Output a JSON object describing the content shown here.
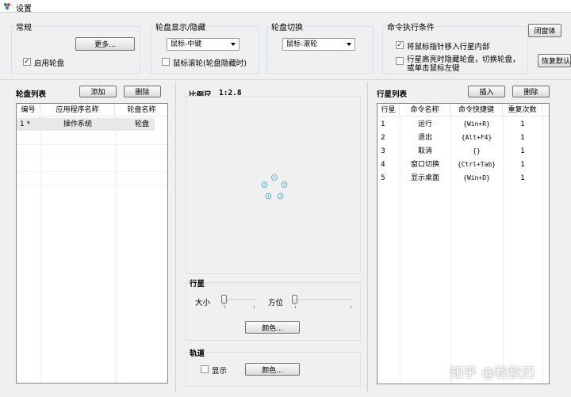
{
  "window": {
    "title": "设置"
  },
  "groups": {
    "general": {
      "label": "常规",
      "more_button": "更多...",
      "enable_wheel": "启用轮盘",
      "enable_wheel_checked": true
    },
    "display": {
      "label": "轮盘显示/隐藏",
      "combo_value": "鼠标-中键",
      "scroll_hide": "鼠标滚轮(轮盘隐藏时)",
      "scroll_hide_checked": false
    },
    "switch": {
      "label": "轮盘切换",
      "combo_value": "鼠标-滚轮"
    },
    "condition": {
      "label": "命令执行条件",
      "opt1": "将鼠标指针移入行星内部",
      "opt1_checked": true,
      "opt2_line1": "行星高亮时隐藏轮盘，切换轮盘，",
      "opt2_line2": "或单击鼠标左键",
      "opt2_checked": false
    }
  },
  "right_buttons": {
    "close": "闭窗体",
    "restore": "恢复默认"
  },
  "wheel_list": {
    "title": "轮盘列表",
    "add_button": "添加",
    "delete_button": "删除",
    "columns": [
      "编号",
      "应用程序名称",
      "轮盘名称"
    ],
    "rows": [
      [
        "1 *",
        "操作系统",
        "轮盘"
      ]
    ]
  },
  "scale": {
    "label": "比例尺",
    "value": "1:2.8"
  },
  "planet": {
    "title": "行星",
    "size_label": "大小",
    "orientation_label": "方位",
    "color_button": "颜色..."
  },
  "orbit": {
    "title": "轨道",
    "show_label": "显示",
    "show_checked": false,
    "color_button": "颜色..."
  },
  "planet_list": {
    "title": "行星列表",
    "insert_button": "插入",
    "delete_button": "删除",
    "columns": [
      "行星",
      "命令名称",
      "命令快捷键",
      "重复次数"
    ],
    "rows": [
      [
        "1",
        "运行",
        "{Win+R}",
        "1"
      ],
      [
        "2",
        "退出",
        "{Alt+F4}",
        "1"
      ],
      [
        "3",
        "取消",
        "{}",
        "1"
      ],
      [
        "4",
        "窗口切换",
        "{Ctrl+Tab}",
        "1"
      ],
      [
        "5",
        "显示桌面",
        "{Win+D}",
        "1"
      ]
    ]
  },
  "preview_planets": [
    "1",
    "2",
    "3",
    "4",
    "5"
  ],
  "watermark": "知乎 @秋秋刃"
}
